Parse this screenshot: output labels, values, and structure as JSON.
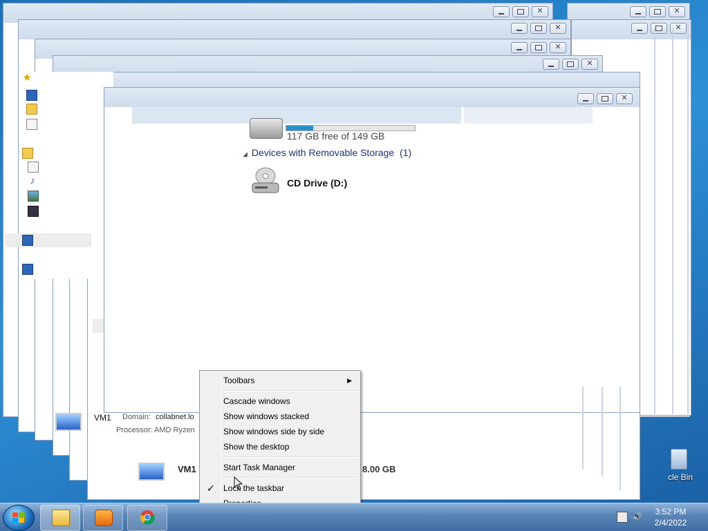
{
  "context_menu": {
    "items": [
      {
        "label": "Toolbars",
        "submenu": true
      },
      {
        "label": "Cascade windows"
      },
      {
        "label": "Show windows stacked"
      },
      {
        "label": "Show windows side by side"
      },
      {
        "label": "Show the desktop"
      },
      {
        "label": "Start Task Manager"
      },
      {
        "label": "Lock the taskbar",
        "checked": true
      },
      {
        "label": "Properties"
      }
    ],
    "check_glyph": "✓",
    "submenu_glyph": "▶"
  },
  "explorer": {
    "drive_free_text": "117 GB free of 149 GB",
    "drive_used_fraction": 0.21,
    "group_header": "Devices with Removable Storage",
    "group_count": "(1)",
    "cd_drive_label": "CD Drive (D:)"
  },
  "details_pane": {
    "computer_name": "VM1",
    "domain_label": "Domain:",
    "domain_value": "collabnet.lo",
    "processor_text": "Processor: AMD Ryzen",
    "computer_name_2": "VM1",
    "memory_text": "8.00 GB"
  },
  "desktop": {
    "recycle_bin_label": "cle Bin"
  },
  "taskbar": {
    "time": "3:52 PM",
    "date": "2/4/2022",
    "pinned": [
      "windows-explorer-icon",
      "media-player-icon",
      "chrome-icon"
    ]
  },
  "colors": {
    "taskbar": "#5b86b8",
    "group_header": "#1e3287",
    "drive_bar": "#2a8fc6"
  }
}
